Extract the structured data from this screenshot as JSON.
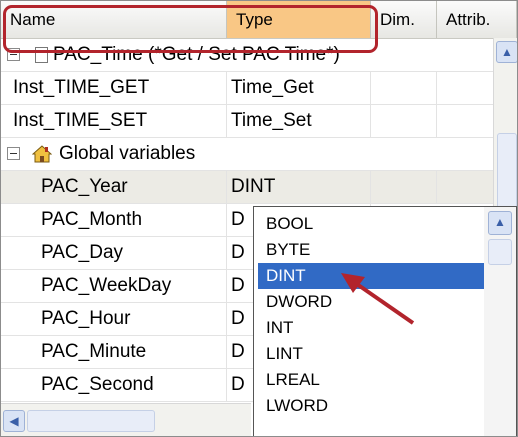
{
  "header": {
    "name": "Name",
    "type": "Type",
    "dim": "Dim.",
    "attrib": "Attrib."
  },
  "groups": [
    {
      "label": "PAC_Time (*Get / Set PAC Time*)",
      "icon": "document-icon"
    },
    {
      "label": "Global variables",
      "icon": "home-icon"
    }
  ],
  "pac_time_rows": [
    {
      "name": "Inst_TIME_GET",
      "type": "Time_Get"
    },
    {
      "name": "Inst_TIME_SET",
      "type": "Time_Set"
    }
  ],
  "global_rows": [
    {
      "name": "PAC_Year",
      "type": "DINT"
    },
    {
      "name": "PAC_Month",
      "type": "D"
    },
    {
      "name": "PAC_Day",
      "type": "D"
    },
    {
      "name": "PAC_WeekDay",
      "type": "D"
    },
    {
      "name": "PAC_Hour",
      "type": "D"
    },
    {
      "name": "PAC_Minute",
      "type": "D"
    },
    {
      "name": "PAC_Second",
      "type": "D"
    }
  ],
  "dropdown": {
    "options": [
      "BOOL",
      "BYTE",
      "DINT",
      "DWORD",
      "INT",
      "LINT",
      "LREAL",
      "LWORD"
    ],
    "selected": "DINT"
  },
  "colors": {
    "highlight_box": "#b2242c",
    "selected_header": "#f9c785",
    "selected_option": "#316ac5",
    "annotation_arrow": "#b2242c"
  }
}
